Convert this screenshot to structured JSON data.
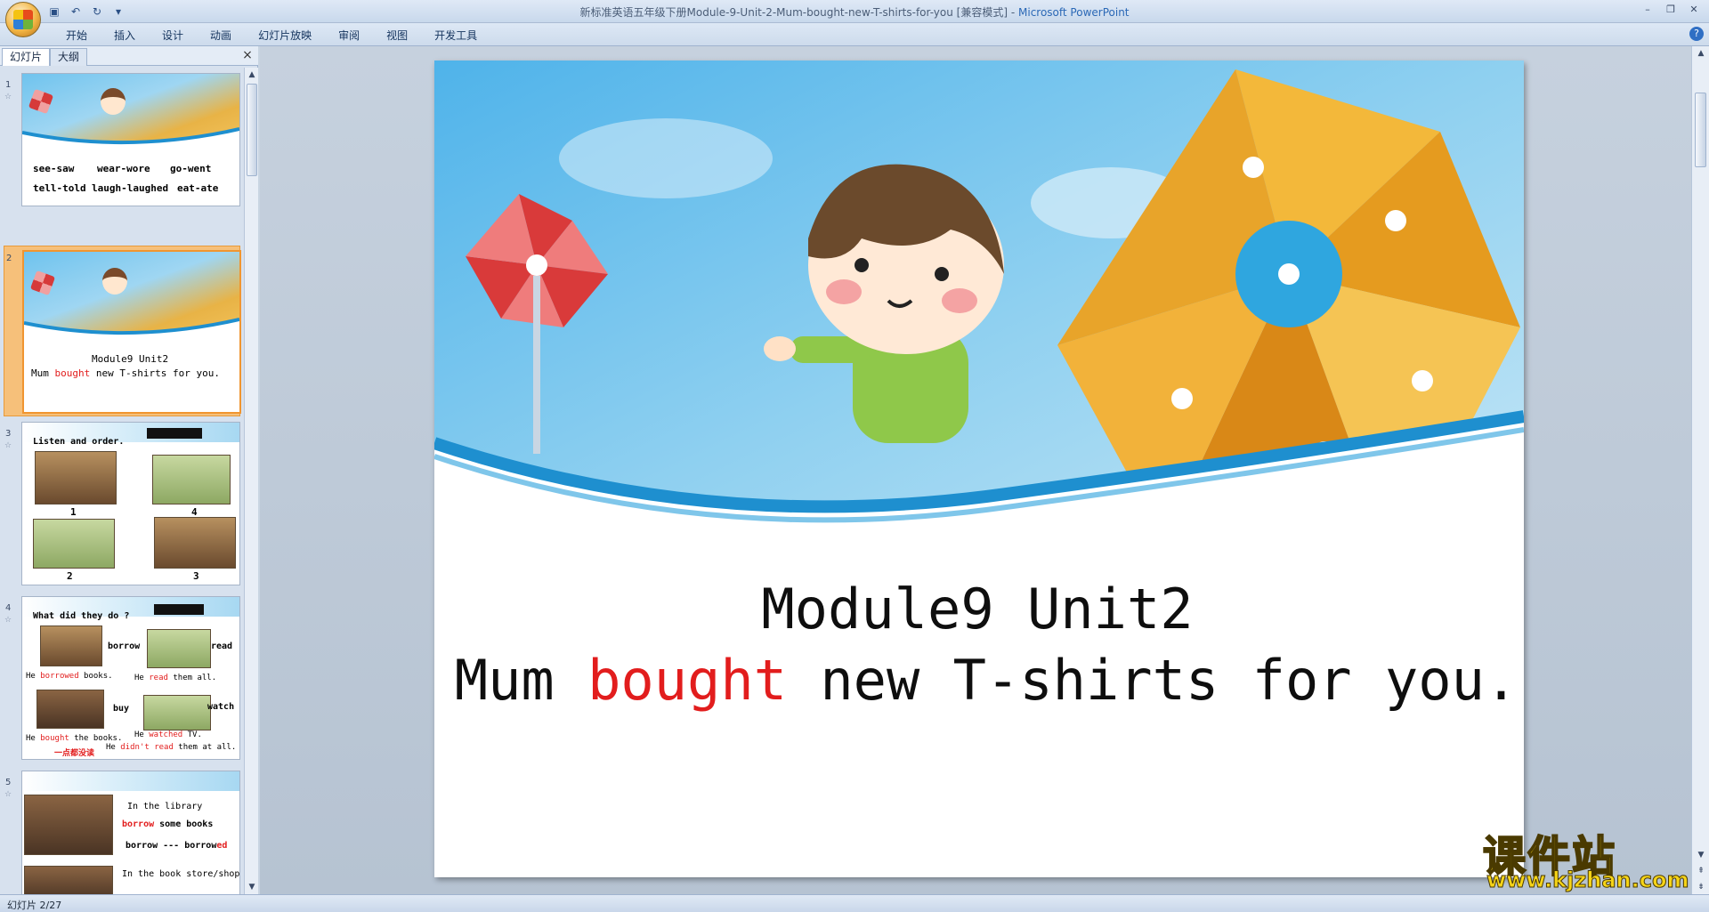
{
  "window": {
    "title_doc": "新标准英语五年级下册Module-9-Unit-2-Mum-bought-new-T-shirts-for-you [兼容模式] - ",
    "title_app": "Microsoft PowerPoint"
  },
  "ribbon": {
    "tabs": [
      "开始",
      "插入",
      "设计",
      "动画",
      "幻灯片放映",
      "审阅",
      "视图",
      "开发工具"
    ]
  },
  "left_panel": {
    "tabs": [
      "幻灯片",
      "大纲"
    ],
    "close": "×"
  },
  "thumbnails": [
    {
      "number": "1",
      "lines": [
        [
          "see-saw",
          "wear-wore",
          "go-went"
        ],
        [
          "tell-told",
          "laugh-laughed",
          "eat-ate"
        ]
      ]
    },
    {
      "number": "2",
      "line1": "Module9 Unit2",
      "line2_a": "Mum ",
      "line2_red": "bought",
      "line2_b": " new T-shirts for you."
    },
    {
      "number": "3",
      "title": "Listen and order.",
      "labels": [
        "1",
        "4",
        "2",
        "3"
      ]
    },
    {
      "number": "4",
      "title": "What did they do ?",
      "words": [
        "borrow",
        "read",
        "buy",
        "watch"
      ],
      "s1_a": "He ",
      "s1_red": "borrowed",
      "s1_b": " books.",
      "s2_a": "He ",
      "s2_red": "read",
      "s2_b": " them all.",
      "s3_a": "He ",
      "s3_red": "bought",
      "s3_b": " the books.",
      "s4_a": "He ",
      "s4_red": "watched",
      "s4_b": " TV.",
      "s5_red": "一点都没读",
      "s6_a": "He ",
      "s6_red": "didn't read",
      "s6_b": " them at all."
    },
    {
      "number": "5",
      "l1": "In the library",
      "l2_red": "borrow",
      "l2_b": " some books",
      "l3_a": "borrow --- borrow",
      "l3_red": "ed",
      "l4": "In the book store/shop"
    }
  ],
  "slide": {
    "title_line1": "Module9 Unit2",
    "title_line2_a": "Mum ",
    "title_line2_red": "bought",
    "title_line2_b": " new T-shirts for you.",
    "accent_red": "#e21d1d"
  },
  "status": {
    "slide_counter": "幻灯片 2/27"
  },
  "watermark": {
    "cn": "课件站",
    "url": "www.kjzhan.com"
  }
}
